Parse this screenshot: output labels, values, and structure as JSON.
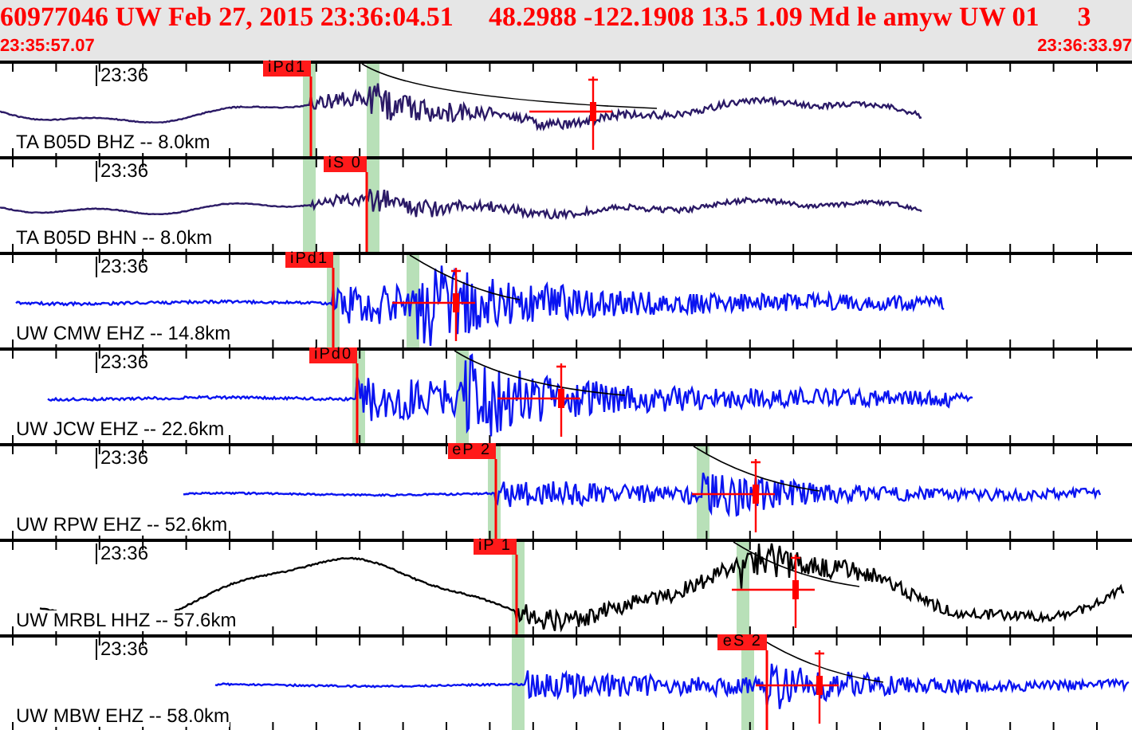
{
  "header": {
    "event_info": "60977046 UW Feb 27, 2015 23:36:04.51",
    "location_info": "48.2988 -122.1908 13.5 1.09 Md le amyw UW 01",
    "count": "3",
    "start_time": "23:35:57.07",
    "end_time": "23:36:33.97"
  },
  "panels": [
    {
      "time_label": "23:36",
      "station": "TA B05D BHZ -- 8.0km",
      "color": "#2b1a66",
      "pick": "iPd1"
    },
    {
      "time_label": "23:36",
      "station": "TA B05D BHN -- 8.0km",
      "color": "#2b1a66",
      "pick": "iS 0"
    },
    {
      "time_label": "23:36",
      "station": "UW CMW EHZ -- 14.8km",
      "color": "#0a14f0",
      "pick": "iPd1"
    },
    {
      "time_label": "23:36",
      "station": "UW JCW EHZ -- 22.6km",
      "color": "#0a14f0",
      "pick": "iPd0"
    },
    {
      "time_label": "23:36",
      "station": "UW RPW EHZ -- 52.6km",
      "color": "#0a14f0",
      "pick": "eP 2"
    },
    {
      "time_label": "23:36",
      "station": "UW MRBL HHZ -- 57.6km",
      "color": "#000000",
      "pick": "iP 1"
    },
    {
      "time_label": "23:36",
      "station": "UW MBW EHZ -- 58.0km",
      "color": "#0a14f0",
      "pick": "eS 2"
    }
  ]
}
